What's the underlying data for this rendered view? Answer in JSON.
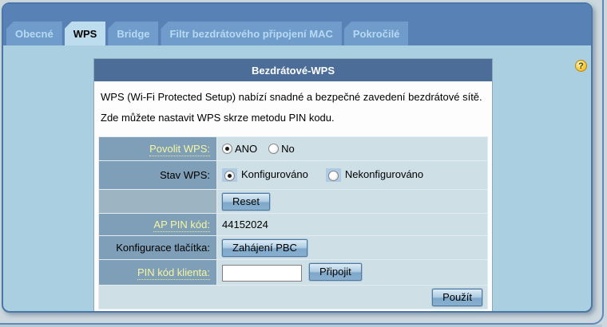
{
  "tabs": {
    "items": [
      {
        "label": "Obecné",
        "selected": false
      },
      {
        "label": "WPS",
        "selected": true
      },
      {
        "label": "Bridge",
        "selected": false
      },
      {
        "label": "Filtr bezdrátového připojení MAC",
        "selected": false
      },
      {
        "label": "Pokročilé",
        "selected": false
      }
    ]
  },
  "help": {
    "icon_glyph": "?"
  },
  "panel": {
    "title": "Bezdrátové-WPS",
    "description": "WPS (Wi-Fi Protected Setup) nabízí snadné a bezpečné zavedení bezdrátové sítě. Zde můžete nastavit WPS skrze metodu PIN kodu.",
    "rows": {
      "enable": {
        "label": "Povolit WPS:",
        "options": [
          "ANO",
          "No"
        ],
        "selected": "ANO"
      },
      "status": {
        "label": "Stav WPS:",
        "options": [
          "Konfigurováno",
          "Nekonfigurováno"
        ],
        "selected": "Konfigurováno"
      },
      "reset": {
        "button": "Reset"
      },
      "ap_pin": {
        "label": "AP PIN kód:",
        "value": "44152024"
      },
      "pbc": {
        "label": "Konfigurace tlačítka:",
        "button": "Zahájení PBC"
      },
      "client_pin": {
        "label": "PIN kód klienta:",
        "value": "",
        "button": "Připojit"
      },
      "apply": {
        "button": "Použít"
      }
    }
  },
  "colors": {
    "band_blue": "#5882b6",
    "panel_header_blue": "#4b6d98",
    "label_cell_blue": "#7e9fb7",
    "value_cell_blue": "#cfdfe6",
    "link_yellow": "#f6f6a0",
    "body_light_blue": "#a9cfe0"
  }
}
